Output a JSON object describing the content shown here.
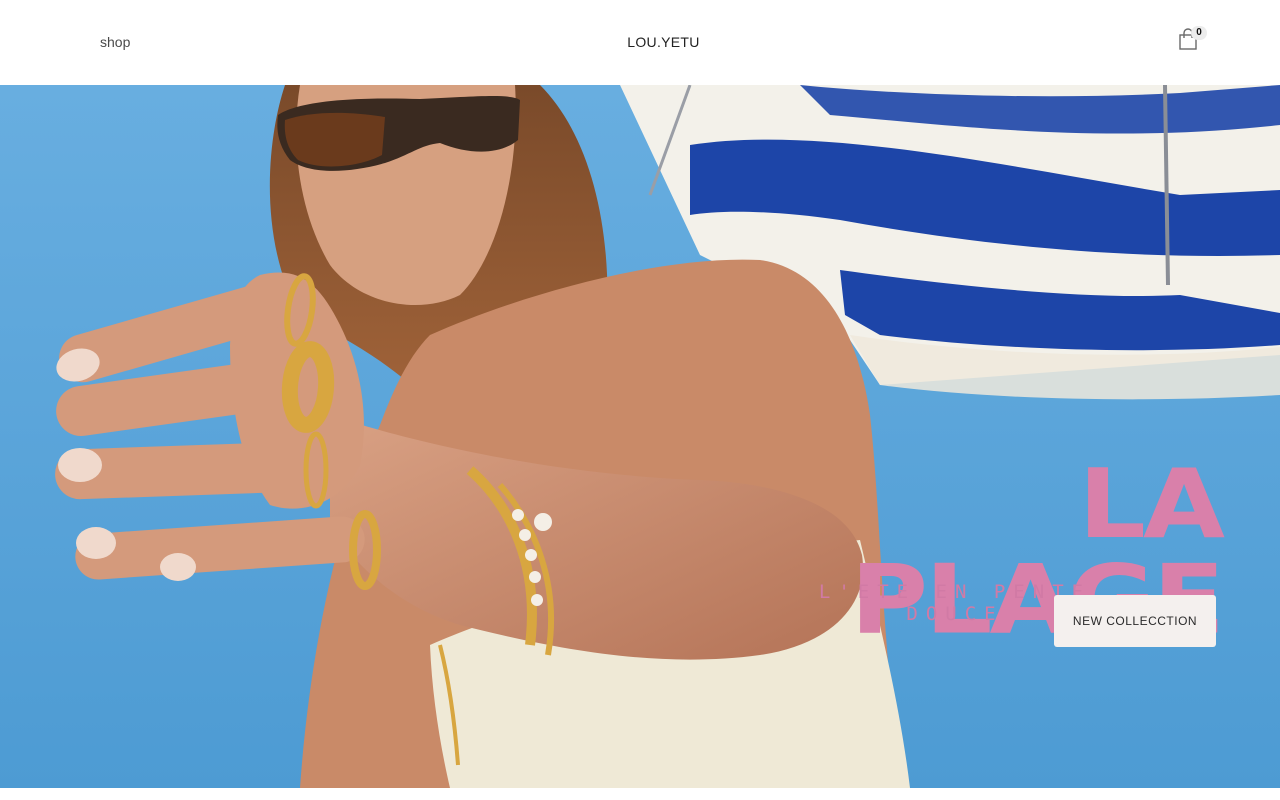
{
  "header": {
    "nav_shop": "shop",
    "brand": "LOU.YETU",
    "cart_count": "0",
    "cart_icon": "shopping-bag-icon"
  },
  "hero": {
    "title": "LA PLAGE",
    "subtitle": "L'ETE EN PENTE DOUCE",
    "cta_label": "NEW COLLECCTION"
  },
  "colors": {
    "sky": "#5aa6d9",
    "umbrella_blue": "#1d45a8",
    "title_pink": "#d980aa",
    "cta_bg": "#f4f0ee"
  }
}
